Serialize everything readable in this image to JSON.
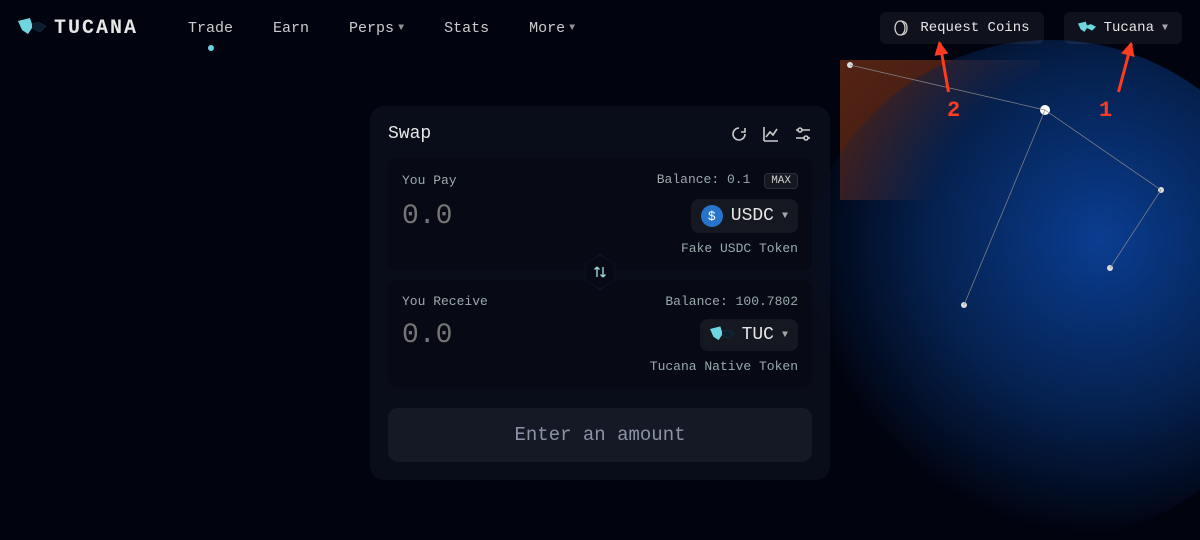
{
  "brand": {
    "name": "TUCANA"
  },
  "nav": {
    "trade": "Trade",
    "earn": "Earn",
    "perps": "Perps",
    "stats": "Stats",
    "more": "More"
  },
  "header": {
    "requestCoins": "Request Coins",
    "network": "Tucana"
  },
  "swap": {
    "title": "Swap",
    "pay": {
      "label": "You Pay",
      "balanceLabel": "Balance: 0.1",
      "max": "MAX",
      "placeholder": "0.0",
      "token": "USDC",
      "tokenDesc": "Fake USDC Token"
    },
    "receive": {
      "label": "You Receive",
      "balanceLabel": "Balance: 100.7802",
      "placeholder": "0.0",
      "token": "TUC",
      "tokenDesc": "Tucana Native Token"
    },
    "action": "Enter an amount"
  },
  "annotations": {
    "a1": "1",
    "a2": "2"
  }
}
